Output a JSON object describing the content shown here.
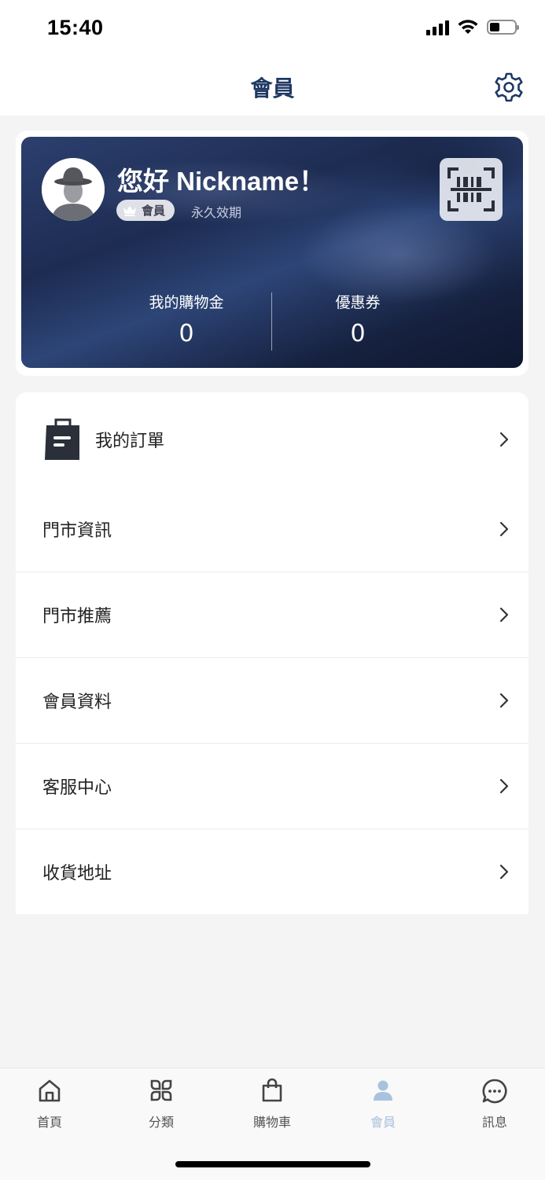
{
  "status_bar": {
    "time": "15:40",
    "battery_level": 0.4
  },
  "header": {
    "title": "會員",
    "settings_icon": "gear-icon"
  },
  "member_card": {
    "greeting": "您好 Nickname！",
    "badge_label": "會員",
    "validity": "永久效期",
    "qr_icon": "barcode-scan-icon",
    "stats": [
      {
        "label": "我的購物金",
        "value": "0"
      },
      {
        "label": "優惠券",
        "value": "0"
      }
    ]
  },
  "orders": {
    "label": "我的訂單",
    "icon": "shopping-bag-icon"
  },
  "menu": [
    {
      "label": "門市資訊"
    },
    {
      "label": "門市推薦"
    },
    {
      "label": "會員資料"
    },
    {
      "label": "客服中心"
    },
    {
      "label": "收貨地址"
    }
  ],
  "tab_bar": {
    "tabs": [
      {
        "label": "首頁",
        "icon": "home-icon"
      },
      {
        "label": "分類",
        "icon": "category-icon"
      },
      {
        "label": "購物車",
        "icon": "cart-bag-icon"
      },
      {
        "label": "會員",
        "icon": "member-icon",
        "active": true
      },
      {
        "label": "訊息",
        "icon": "message-icon"
      }
    ],
    "active_color": "#a9c2dd"
  },
  "colors": {
    "brand_navy": "#1f3864",
    "page_bg": "#f4f4f5"
  }
}
